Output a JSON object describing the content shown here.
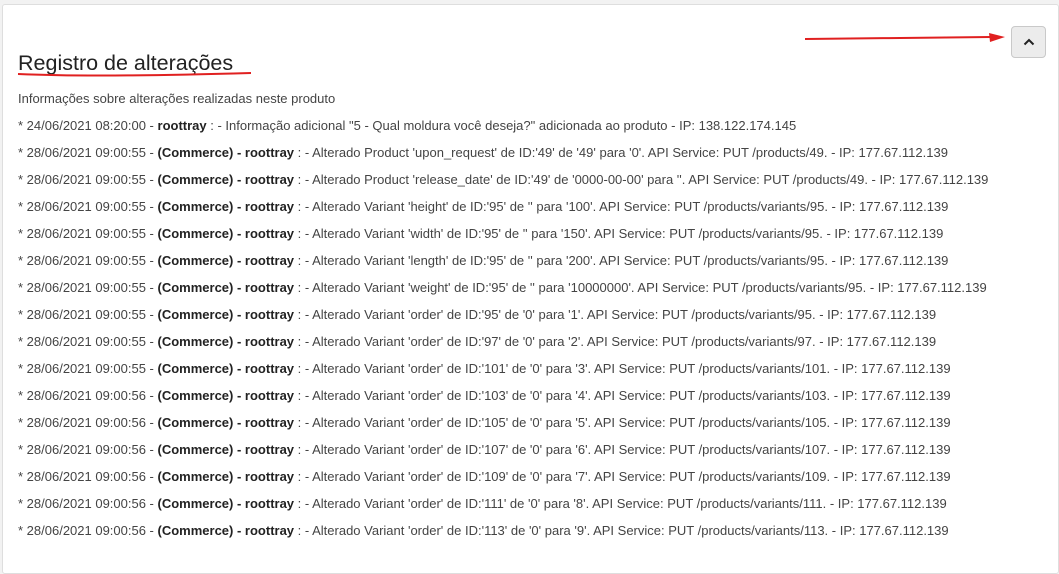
{
  "panel": {
    "title": "Registro de alterações",
    "subtitle": "Informações sobre alterações realizadas neste produto",
    "collapse_icon": "chevron-up-icon"
  },
  "annotation_color": "#e02020",
  "log_entries": [
    {
      "prefix": "* 24/06/2021 08:20:00 - ",
      "user": "roottray",
      "message": " : - Informação adicional \"5 - Qual moldura você deseja?\" adicionada ao produto - IP: 138.122.174.145"
    },
    {
      "prefix": "* 28/06/2021 09:00:55 - ",
      "user": "(Commerce) - roottray",
      "message": " : - Alterado Product 'upon_request' de ID:'49' de '49' para '0'. API Service: PUT /products/49. - IP: 177.67.112.139"
    },
    {
      "prefix": "* 28/06/2021 09:00:55 - ",
      "user": "(Commerce) - roottray",
      "message": " : - Alterado Product 'release_date' de ID:'49' de '0000-00-00' para ''. API Service: PUT /products/49. - IP: 177.67.112.139"
    },
    {
      "prefix": "* 28/06/2021 09:00:55 - ",
      "user": "(Commerce) - roottray",
      "message": " : - Alterado Variant 'height' de ID:'95' de '' para '100'. API Service: PUT /products/variants/95. - IP: 177.67.112.139"
    },
    {
      "prefix": "* 28/06/2021 09:00:55 - ",
      "user": "(Commerce) - roottray",
      "message": " : - Alterado Variant 'width' de ID:'95' de '' para '150'. API Service: PUT /products/variants/95. - IP: 177.67.112.139"
    },
    {
      "prefix": "* 28/06/2021 09:00:55 - ",
      "user": "(Commerce) - roottray",
      "message": " : - Alterado Variant 'length' de ID:'95' de '' para '200'. API Service: PUT /products/variants/95. - IP: 177.67.112.139"
    },
    {
      "prefix": "* 28/06/2021 09:00:55 - ",
      "user": "(Commerce) - roottray",
      "message": " : - Alterado Variant 'weight' de ID:'95' de '' para '10000000'. API Service: PUT /products/variants/95. - IP: 177.67.112.139"
    },
    {
      "prefix": "* 28/06/2021 09:00:55 - ",
      "user": "(Commerce) - roottray",
      "message": " : - Alterado Variant 'order' de ID:'95' de '0' para '1'. API Service: PUT /products/variants/95. - IP: 177.67.112.139"
    },
    {
      "prefix": "* 28/06/2021 09:00:55 - ",
      "user": "(Commerce) - roottray",
      "message": " : - Alterado Variant 'order' de ID:'97' de '0' para '2'. API Service: PUT /products/variants/97. - IP: 177.67.112.139"
    },
    {
      "prefix": "* 28/06/2021 09:00:55 - ",
      "user": "(Commerce) - roottray",
      "message": " : - Alterado Variant 'order' de ID:'101' de '0' para '3'. API Service: PUT /products/variants/101. - IP: 177.67.112.139"
    },
    {
      "prefix": "* 28/06/2021 09:00:56 - ",
      "user": "(Commerce) - roottray",
      "message": " : - Alterado Variant 'order' de ID:'103' de '0' para '4'. API Service: PUT /products/variants/103. - IP: 177.67.112.139"
    },
    {
      "prefix": "* 28/06/2021 09:00:56 - ",
      "user": "(Commerce) - roottray",
      "message": " : - Alterado Variant 'order' de ID:'105' de '0' para '5'. API Service: PUT /products/variants/105. - IP: 177.67.112.139"
    },
    {
      "prefix": "* 28/06/2021 09:00:56 - ",
      "user": "(Commerce) - roottray",
      "message": " : - Alterado Variant 'order' de ID:'107' de '0' para '6'. API Service: PUT /products/variants/107. - IP: 177.67.112.139"
    },
    {
      "prefix": "* 28/06/2021 09:00:56 - ",
      "user": "(Commerce) - roottray",
      "message": " : - Alterado Variant 'order' de ID:'109' de '0' para '7'. API Service: PUT /products/variants/109. - IP: 177.67.112.139"
    },
    {
      "prefix": "* 28/06/2021 09:00:56 - ",
      "user": "(Commerce) - roottray",
      "message": " : - Alterado Variant 'order' de ID:'111' de '0' para '8'. API Service: PUT /products/variants/111. - IP: 177.67.112.139"
    },
    {
      "prefix": "* 28/06/2021 09:00:56 - ",
      "user": "(Commerce) - roottray",
      "message": " : - Alterado Variant 'order' de ID:'113' de '0' para '9'. API Service: PUT /products/variants/113. - IP: 177.67.112.139"
    }
  ]
}
